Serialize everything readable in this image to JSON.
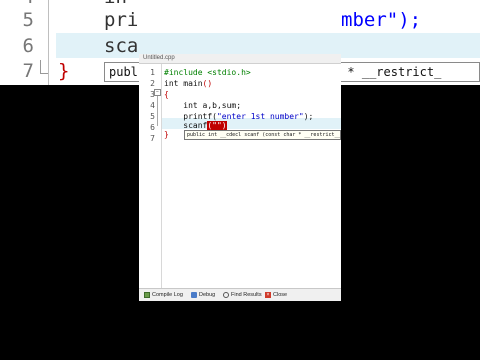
{
  "zoom": {
    "line_numbers": [
      "4",
      "5",
      "6",
      "7"
    ],
    "line4": "in",
    "line5_prefix": "pri",
    "line5_string": "mber\");",
    "line6": "sca",
    "line7_brace": "}",
    "tooltip": "publ                        char * __restrict_"
  },
  "editor": {
    "tab_title": "Untitled.cpp",
    "line_numbers": [
      "1",
      "2",
      "3",
      "4",
      "5",
      "6",
      "7"
    ],
    "lines": {
      "l1_directive": "#include <stdio.h>",
      "l2": "int main",
      "l2_paren": "()",
      "l3": "{",
      "l4": "    int a,b,sum;",
      "l5_prefix": "    printf(",
      "l5_string": "\"enter 1st number\"",
      "l5_suffix": ");",
      "l6_prefix": "    scanf",
      "l6_cursor": "(\"\")",
      "l7": "}"
    },
    "tooltip": "public int __cdecl scanf (const char * __restrict__"
  },
  "bottom_tabs": [
    {
      "label": "Compile Log",
      "icon": "compile-log-icon"
    },
    {
      "label": "Debug",
      "icon": "debug-icon"
    },
    {
      "label": "Find Results",
      "icon": "find-results-icon"
    },
    {
      "label": "Close",
      "icon": "close-icon"
    }
  ],
  "colors": {
    "current_line": "#e1f2f8",
    "bracket": "#c00000",
    "string": "#0000c8",
    "directive": "#008000"
  }
}
